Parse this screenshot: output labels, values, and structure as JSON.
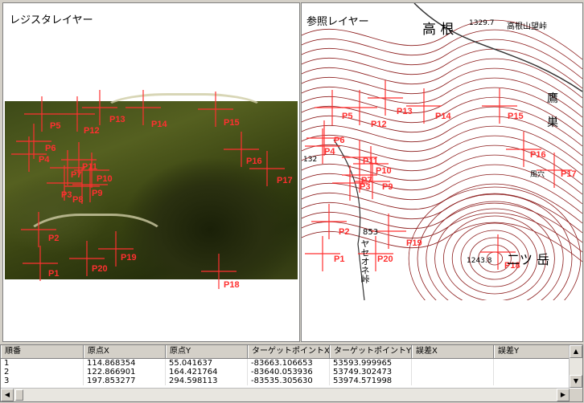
{
  "left_panel": {
    "title": "レジスタレイヤー"
  },
  "right_panel": {
    "title": "参照レイヤー"
  },
  "map_labels": {
    "takane": "高 根",
    "peak_elev": "1329.7",
    "peak_name": "高根山望峠",
    "elev_132": "132",
    "kanji_1": "鷹",
    "kanji_2": "巣",
    "kanji_3": "風穴",
    "elev_853": "853",
    "pass_name": "ヤセオネ峠",
    "elev_1243": "1243.8",
    "futatsu": "二ツ 岳"
  },
  "left_points": [
    {
      "label": "P5"
    },
    {
      "label": "P12"
    },
    {
      "label": "P13"
    },
    {
      "label": "P14"
    },
    {
      "label": "P15"
    },
    {
      "label": "P6"
    },
    {
      "label": "P4"
    },
    {
      "label": "P11"
    },
    {
      "label": "P7"
    },
    {
      "label": "P10"
    },
    {
      "label": "P3"
    },
    {
      "label": "P8"
    },
    {
      "label": "P9"
    },
    {
      "label": "P16"
    },
    {
      "label": "P17"
    },
    {
      "label": "P2"
    },
    {
      "label": "P19"
    },
    {
      "label": "P20"
    },
    {
      "label": "P1"
    },
    {
      "label": "P18"
    }
  ],
  "right_points": [
    {
      "label": "P5"
    },
    {
      "label": "P12"
    },
    {
      "label": "P13"
    },
    {
      "label": "P14"
    },
    {
      "label": "P15"
    },
    {
      "label": "P6"
    },
    {
      "label": "P4"
    },
    {
      "label": "P11"
    },
    {
      "label": "P7"
    },
    {
      "label": "P10"
    },
    {
      "label": "P3"
    },
    {
      "label": "P9"
    },
    {
      "label": "P16"
    },
    {
      "label": "P17"
    },
    {
      "label": "P2"
    },
    {
      "label": "P19"
    },
    {
      "label": "P20"
    },
    {
      "label": "P1"
    },
    {
      "label": "P18"
    }
  ],
  "table": {
    "columns": [
      "順番",
      "原点X",
      "原点Y",
      "ターゲットポイントX",
      "ターゲットポイントY",
      "誤差X",
      "誤差Y"
    ],
    "rows": [
      [
        "1",
        "114.868354",
        "55.041637",
        "-83663.106653",
        "53593.999965",
        "",
        ""
      ],
      [
        "2",
        "122.866901",
        "164.421764",
        "-83640.053936",
        "53749.302473",
        "",
        ""
      ],
      [
        "3",
        "197.853277",
        "294.598113",
        "-83535.305630",
        "53974.571998",
        "",
        ""
      ]
    ]
  },
  "colors": {
    "point": "#ff3030",
    "contour": "#8b1a1a",
    "window_bg": "#d4d0c8"
  }
}
